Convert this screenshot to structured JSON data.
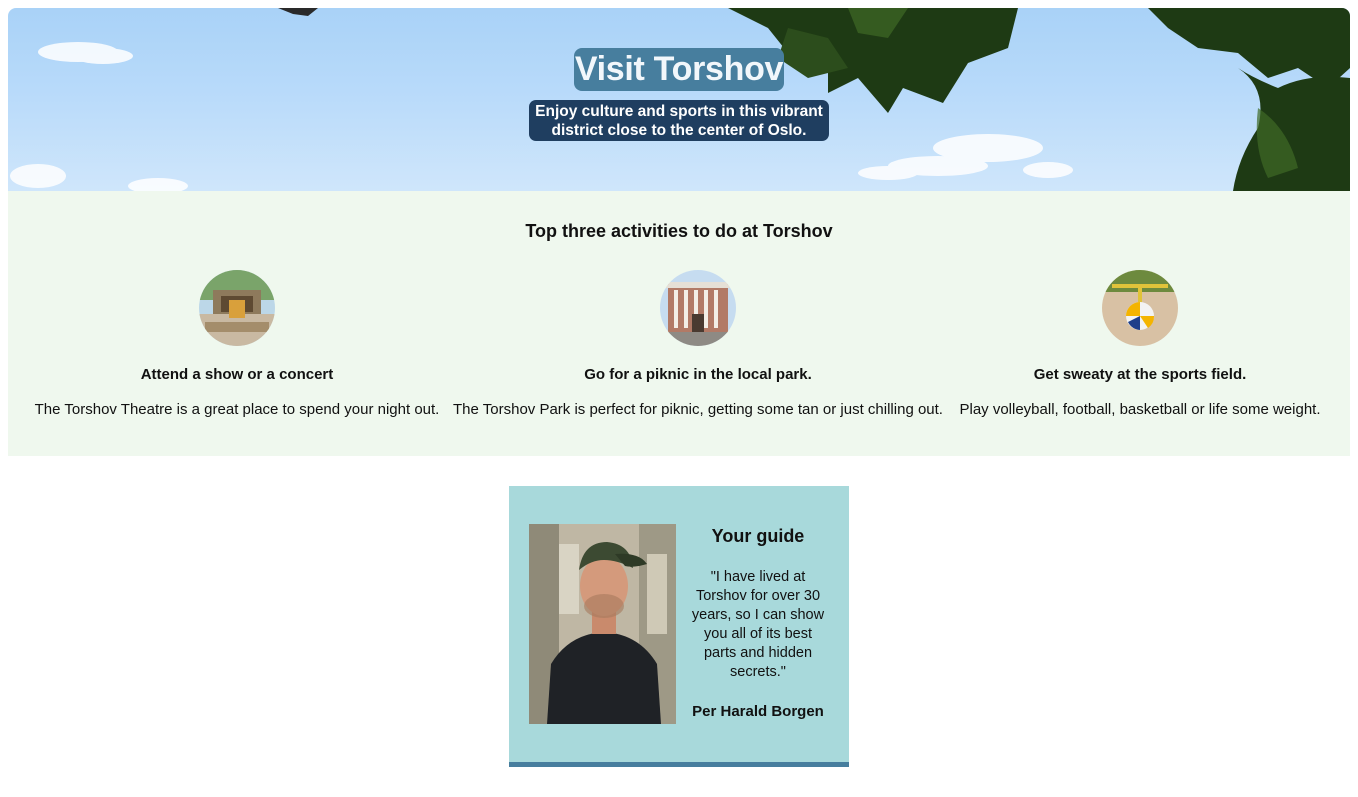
{
  "hero": {
    "title": "Visit Torshov",
    "subtitle": "Enjoy culture and sports in this vibrant district close to the center of Oslo."
  },
  "activities": {
    "heading": "Top three activities to do at Torshov",
    "items": [
      {
        "title": "Attend a show or a concert",
        "description": "The Torshov Theatre is a great place to spend your night out.",
        "icon": "theatre-photo"
      },
      {
        "title": "Go for a piknic in the local park.",
        "description": "The Torshov Park is perfect for piknic, getting some tan or just chilling out.",
        "icon": "park-building-photo"
      },
      {
        "title": "Get sweaty at the sports field.",
        "description": "Play volleyball, football, basketball or life some weight.",
        "icon": "volleyball-photo"
      }
    ]
  },
  "guide": {
    "heading": "Your guide",
    "quote": "\"I have lived at Torshov for over 30 years, so I can show you all of its best parts and hidden secrets.\"",
    "name": "Per Harald Borgen"
  },
  "colors": {
    "title_bg": "#477e9e",
    "subtitle_bg": "#1f3e60",
    "activities_bg": "#eff8ee",
    "guide_bg": "#a8d9db",
    "guide_border": "#477e9e"
  }
}
